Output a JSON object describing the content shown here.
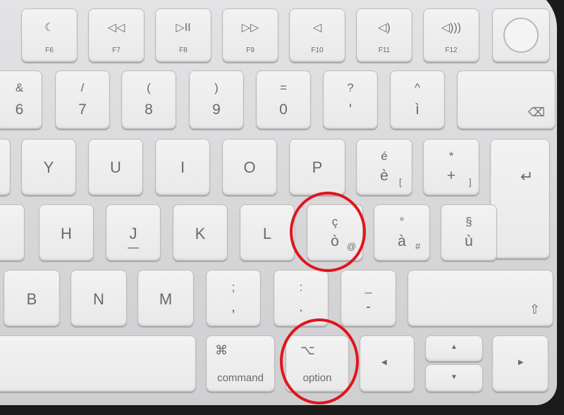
{
  "function_row": [
    {
      "icon": "moon-icon",
      "glyph": "☾",
      "label": "F6"
    },
    {
      "icon": "rewind-icon",
      "glyph": "◁◁",
      "label": "F7"
    },
    {
      "icon": "play-pause-icon",
      "glyph": "▷II",
      "label": "F8"
    },
    {
      "icon": "fast-forward-icon",
      "glyph": "▷▷",
      "label": "F9"
    },
    {
      "icon": "mute-icon",
      "glyph": "◁",
      "label": "F10"
    },
    {
      "icon": "volume-down-icon",
      "glyph": "◁)",
      "label": "F11"
    },
    {
      "icon": "volume-up-icon",
      "glyph": "◁)))",
      "label": "F12"
    }
  ],
  "number_row": [
    {
      "top": "&",
      "bottom": "6"
    },
    {
      "top": "/",
      "bottom": "7"
    },
    {
      "top": "(",
      "bottom": "8"
    },
    {
      "top": ")",
      "bottom": "9"
    },
    {
      "top": "=",
      "bottom": "0"
    },
    {
      "top": "?",
      "bottom": "'"
    },
    {
      "top": "^",
      "bottom": "ì"
    }
  ],
  "delete_glyph": "⌫",
  "top_row": [
    "Y",
    "U",
    "I",
    "O",
    "P"
  ],
  "e_key": {
    "top": "é",
    "bottom": "è",
    "alt": "["
  },
  "plus_key": {
    "top": "*",
    "bottom": "+",
    "alt": "]"
  },
  "return_glyph": "↵",
  "home_row": [
    "H",
    "J",
    "K",
    "L"
  ],
  "c_key": {
    "top": "ç",
    "bottom": "ò",
    "alt": "@"
  },
  "a_key": {
    "top": "°",
    "bottom": "à",
    "alt": "#"
  },
  "u_key": {
    "top": "§",
    "bottom": "ù"
  },
  "bottom_row": [
    "B",
    "N",
    "M"
  ],
  "semicolon_key": {
    "top": ";",
    "bottom": ","
  },
  "colon_key": {
    "top": ":",
    "bottom": "."
  },
  "dash_key": {
    "top": "_",
    "bottom": "-"
  },
  "shift_glyph": "⇧",
  "command": {
    "glyph": "⌘",
    "label": "command"
  },
  "option": {
    "glyph": "⌥",
    "label": "option"
  },
  "arrows": {
    "left": "◀",
    "up": "▲",
    "down": "▼",
    "right": "▶"
  },
  "highlight_color": "#e1151b"
}
